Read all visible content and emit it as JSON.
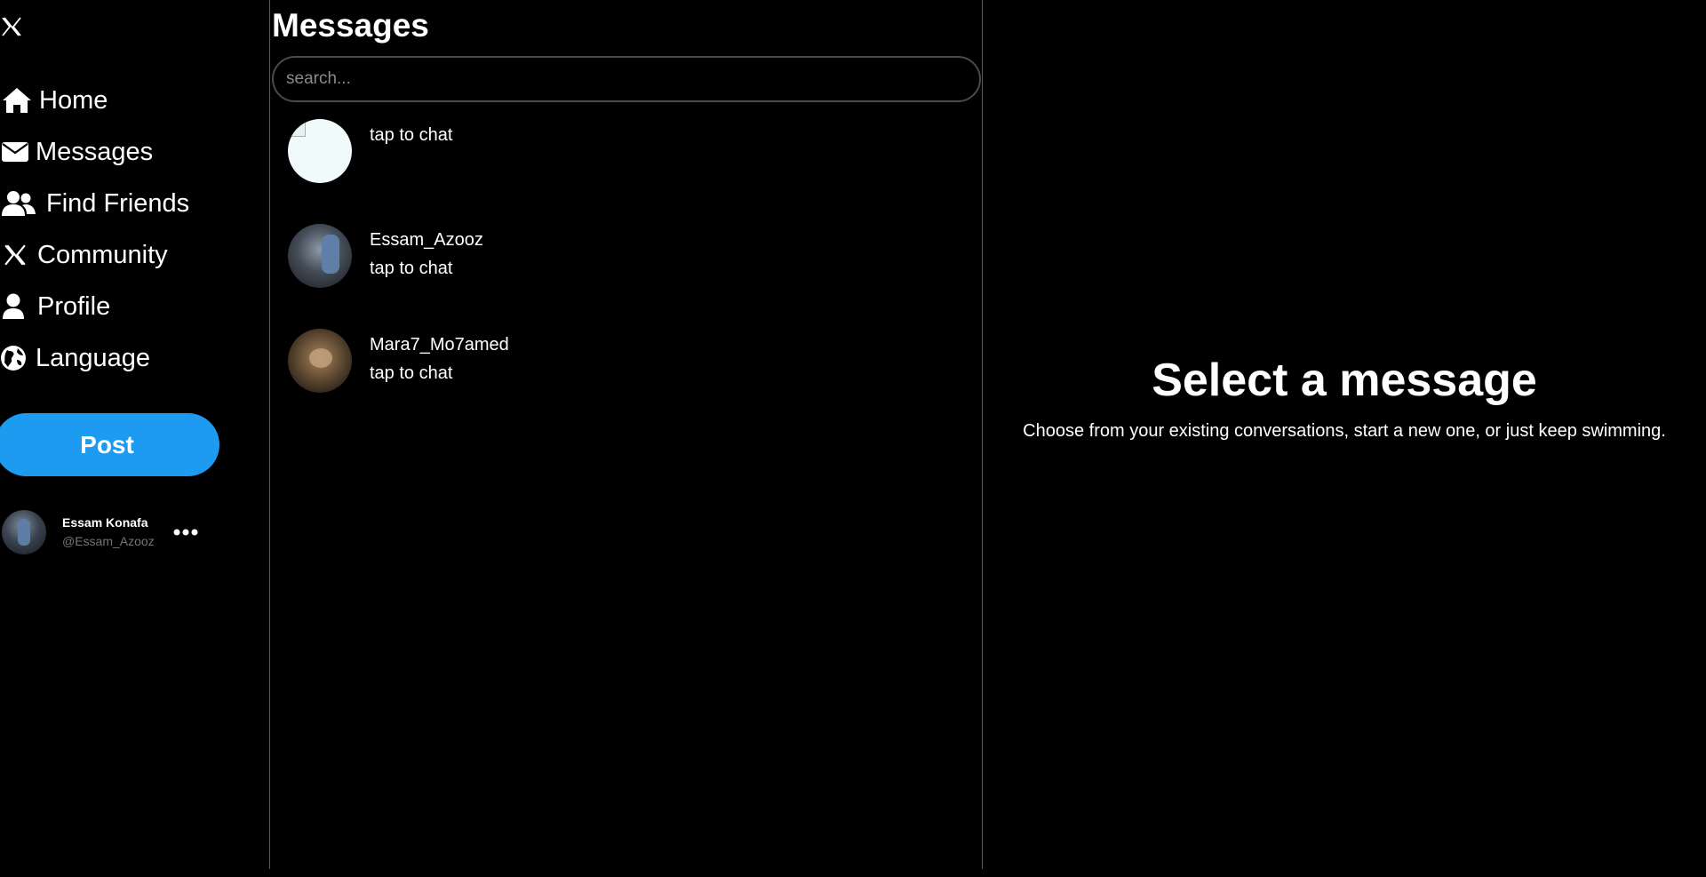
{
  "sidebar": {
    "logo_icon": "x-logo-icon",
    "nav": [
      {
        "label": "Home",
        "icon": "home-icon"
      },
      {
        "label": "Messages",
        "icon": "envelope-icon"
      },
      {
        "label": "Find Friends",
        "icon": "users-icon"
      },
      {
        "label": "Community",
        "icon": "x-logo-icon"
      },
      {
        "label": "Profile",
        "icon": "user-icon"
      },
      {
        "label": "Language",
        "icon": "globe-icon"
      }
    ],
    "post_label": "Post",
    "account": {
      "display_name": "Essam Konafa",
      "handle": "@Essam_Azooz",
      "more_icon": "more-dots-icon"
    }
  },
  "messages": {
    "title": "Messages",
    "search_placeholder": "search...",
    "conversations": [
      {
        "name": "",
        "subtitle": "tap to chat",
        "avatar": "broken-image"
      },
      {
        "name": "Essam_Azooz",
        "subtitle": "tap to chat",
        "avatar": "person-photo"
      },
      {
        "name": "Mara7_Mo7amed",
        "subtitle": "tap to chat",
        "avatar": "cat-photo"
      }
    ]
  },
  "detail": {
    "title": "Select a message",
    "subtitle": "Choose from your existing conversations, start a new one, or just keep swimming."
  },
  "colors": {
    "background": "#000000",
    "accent": "#1d9bf0",
    "divider": "#5a5a5a",
    "muted_text": "#71767b"
  }
}
